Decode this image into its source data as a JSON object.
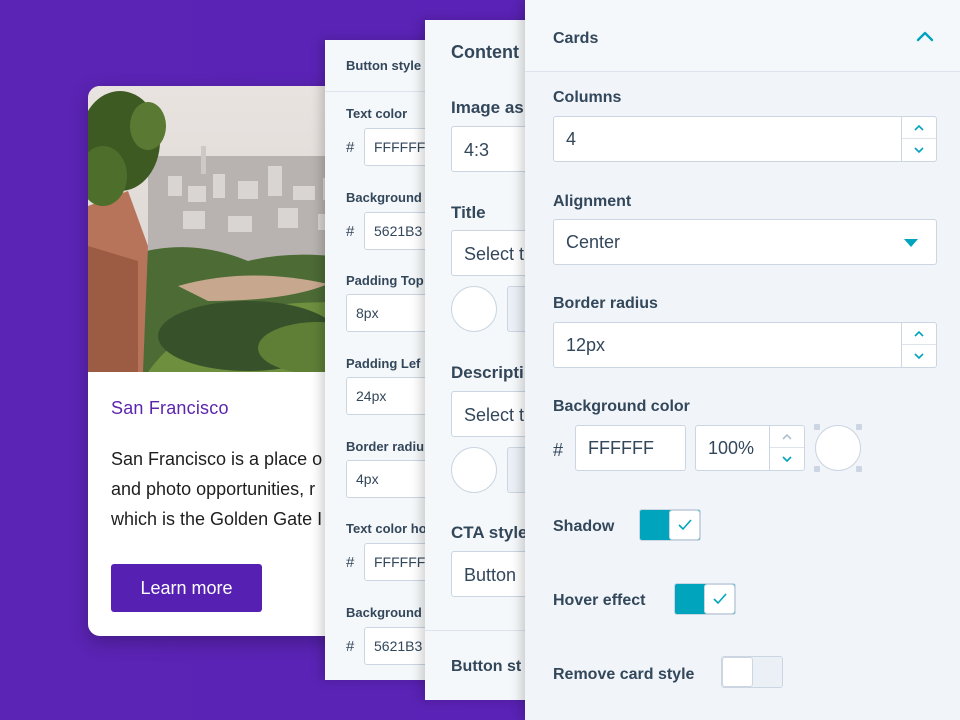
{
  "card": {
    "title": "San Francisco",
    "description_lines": [
      "San Francisco is a place o",
      "and photo opportunities, r",
      "which is the Golden Gate I"
    ],
    "button_label": "Learn more"
  },
  "button_style_panel": {
    "header": "Button style",
    "fields": [
      {
        "label": "Text color",
        "value": "FFFFFF",
        "hash": "#"
      },
      {
        "label": "Background",
        "value": "5621B3",
        "hash": "#"
      },
      {
        "label": "Padding Top",
        "value": "8px"
      },
      {
        "label": "Padding Lef",
        "value": "24px"
      },
      {
        "label": "Border radiu",
        "value": "4px"
      },
      {
        "label": "Text color ho",
        "value": "FFFFFF",
        "hash": "#"
      },
      {
        "label": "Background",
        "value": "5621B3",
        "hash": "#"
      }
    ]
  },
  "content_panel": {
    "header": "Content",
    "image_aspect_label": "Image as",
    "image_aspect_value": "4:3",
    "title_label": "Title",
    "title_select": "Select t",
    "description_label": "Descripti",
    "description_select": "Select t",
    "cta_label": "CTA style",
    "cta_value": "Button",
    "footer_label": "Button st"
  },
  "cards_panel": {
    "header": "Cards",
    "columns_label": "Columns",
    "columns_value": "4",
    "alignment_label": "Alignment",
    "alignment_value": "Center",
    "border_radius_label": "Border radius",
    "border_radius_value": "12px",
    "background_color_label": "Background color",
    "hash": "#",
    "background_color_value": "FFFFFF",
    "opacity_value": "100%",
    "shadow_label": "Shadow",
    "shadow_on": true,
    "hover_label": "Hover effect",
    "hover_on": true,
    "remove_card_label": "Remove card style",
    "remove_card_on": false
  },
  "colors": {
    "background": "#5b23b5",
    "brand": "#5621b3",
    "toggle_on": "#00a4bd",
    "text": "#33475b"
  }
}
